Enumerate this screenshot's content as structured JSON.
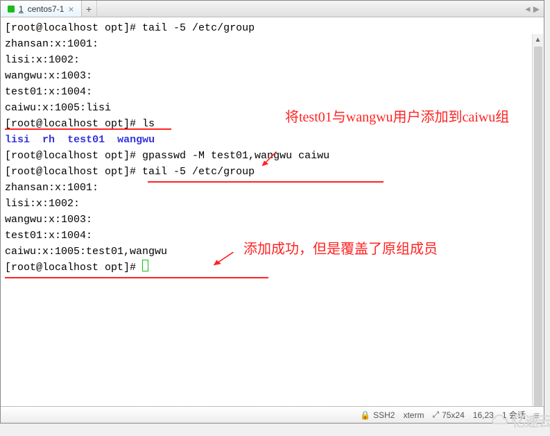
{
  "tab": {
    "index": "1",
    "label": "centos7-1"
  },
  "nav": {
    "left": "◄",
    "right": "▶"
  },
  "terminal": {
    "l1_prompt": "[root@localhost opt]# ",
    "l1_cmd": "tail -5 /etc/group",
    "l2": "zhansan:x:1001:",
    "l3": "lisi:x:1002:",
    "l4": "wangwu:x:1003:",
    "l5": "test01:x:1004:",
    "l6": "caiwu:x:1005:lisi",
    "l7_prompt": "[root@localhost opt]# ",
    "l7_cmd": "ls",
    "l8_a": "lisi",
    "l8_b": "rh",
    "l8_c": "test01",
    "l8_d": "wangwu",
    "l9_prompt": "[root@localhost opt]#",
    "l9_cmd": " gpasswd -M test01,wangwu caiwu",
    "l10_prompt": "[root@localhost opt]# ",
    "l10_cmd": "tail -5 /etc/group",
    "l11": "zhansan:x:1001:",
    "l12": "lisi:x:1002:",
    "l13": "wangwu:x:1003:",
    "l14": "test01:x:1004:",
    "l15": "caiwu:x:1005:test01,wangwu",
    "l16_prompt": "[root@localhost opt]# "
  },
  "annot": {
    "a1": "将test01与wangwu用户添加到caiwu组",
    "a2": "添加成功，但是覆盖了原组成员"
  },
  "status": {
    "ssh": "SSH2",
    "term": "xterm",
    "size": "75x24",
    "pos": "16,23",
    "sess": "1 会话"
  },
  "watermark": "亿速云"
}
